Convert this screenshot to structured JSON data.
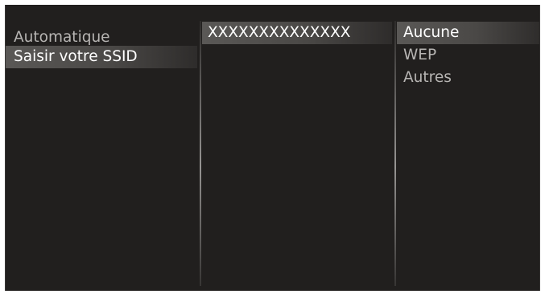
{
  "columns": {
    "connection": {
      "items": [
        {
          "label": "Automatique",
          "selected": false
        },
        {
          "label": "Saisir votre SSID",
          "selected": true
        }
      ]
    },
    "ssid": {
      "value": "XXXXXXXXXXXXXX",
      "selected": true
    },
    "security": {
      "items": [
        {
          "label": "Aucune",
          "selected": true
        },
        {
          "label": "WEP",
          "selected": false
        },
        {
          "label": "Autres",
          "selected": false
        }
      ]
    }
  },
  "colors": {
    "background": "#211f1e",
    "text": "#b7b5b3",
    "selected_text": "#ffffff",
    "highlight": "#5a5856"
  }
}
